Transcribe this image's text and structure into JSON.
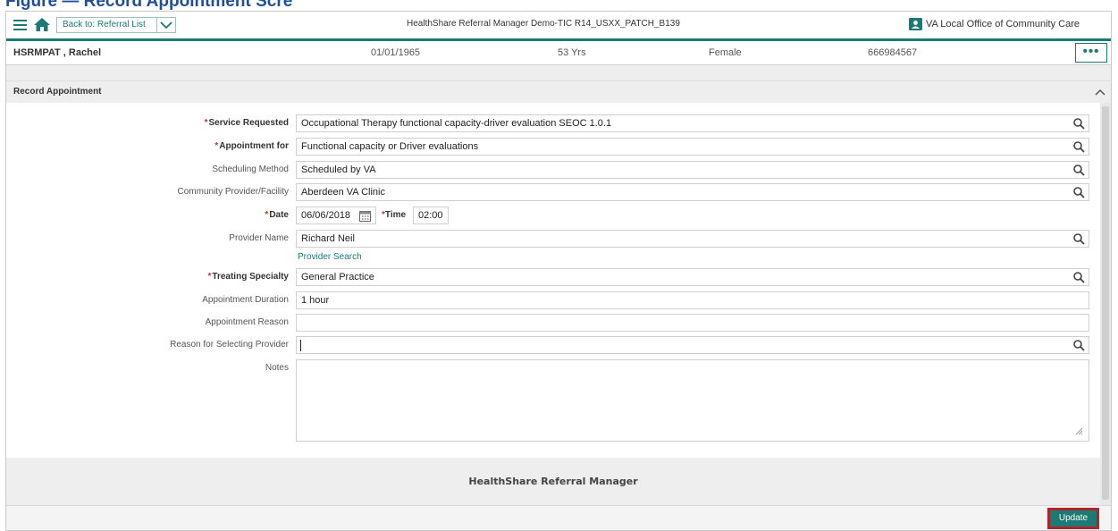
{
  "caption": "Figure — Record Appointment Scre",
  "header": {
    "back_label": "Back to: Referral List",
    "app_title": "HealthShare Referral Manager Demo-TIC R14_USXX_PATCH_B139",
    "facility": "VA Local Office of Community Care"
  },
  "patient": {
    "name": "HSRMPAT , Rachel",
    "dob": "01/01/1965",
    "age": "53 Yrs",
    "sex": "Female",
    "id": "666984567",
    "more": "•••"
  },
  "section": {
    "title": "Record Appointment"
  },
  "form": {
    "service_requested": {
      "label": "Service Requested",
      "value": "Occupational Therapy functional capacity-driver evaluation SEOC 1.0.1"
    },
    "appointment_for": {
      "label": "Appointment for",
      "value": "Functional capacity or Driver evaluations"
    },
    "scheduling_method": {
      "label": "Scheduling Method",
      "value": "Scheduled by VA"
    },
    "community_provider": {
      "label": "Community Provider/Facility",
      "value": "Aberdeen VA Clinic"
    },
    "date": {
      "label": "Date",
      "value": "06/06/2018"
    },
    "time": {
      "label": "Time",
      "value": "02:00"
    },
    "provider_name": {
      "label": "Provider Name",
      "value": "Richard Neil"
    },
    "provider_search": "Provider Search",
    "treating_specialty": {
      "label": "Treating Specialty",
      "value": "General Practice"
    },
    "appointment_duration": {
      "label": "Appointment Duration",
      "value": "1 hour"
    },
    "appointment_reason": {
      "label": "Appointment Reason",
      "value": ""
    },
    "reason_selecting": {
      "label": "Reason for Selecting Provider",
      "value": ""
    },
    "notes": {
      "label": "Notes",
      "value": ""
    }
  },
  "footer": {
    "brand": "HealthShare Referral Manager",
    "update_label": "Update"
  },
  "colors": {
    "accent": "#1b7a73",
    "required": "#c0392b",
    "highlight": "#b3242a"
  },
  "icons": [
    "menu-icon",
    "home-icon",
    "chevron-down-icon",
    "id-card-icon",
    "chevron-up-icon",
    "search-icon",
    "calendar-icon",
    "resize-handle-icon"
  ]
}
